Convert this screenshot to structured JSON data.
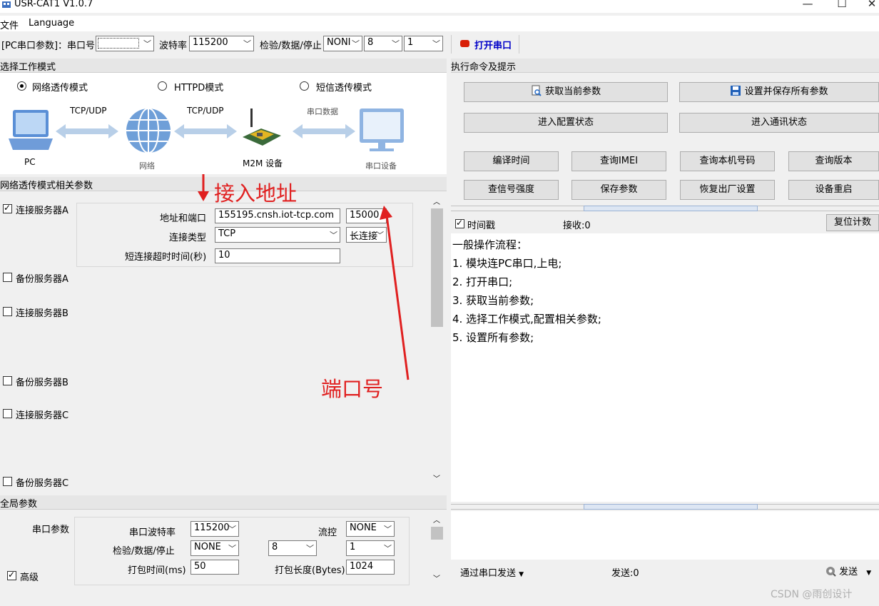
{
  "window": {
    "title": "USR-CAT1 V1.0.7",
    "controls": {
      "minimize": "—",
      "maximize": "☐",
      "close": "✕"
    }
  },
  "menu": {
    "file": "文件",
    "language": "Language"
  },
  "toolbar": {
    "pc_serial_label": "[PC串口参数]：串口号",
    "port_value": "",
    "baud_label": "波特率",
    "baud_value": "115200",
    "parity_label": "检验/数据/停止",
    "parity_value": "NONI",
    "data_bits": "8",
    "stop_bits": "1",
    "open_port_button": "打开串口",
    "accent_color": "#d81e06",
    "button_text_color": "#0000c8"
  },
  "work_mode": {
    "header": "选择工作模式",
    "options": [
      "网络透传模式",
      "HTTPD模式",
      "短信透传模式"
    ],
    "selected_index": 0,
    "diagram": {
      "pc_label": "PC",
      "link1_label": "TCP/UDP",
      "network_label": "网络",
      "link2_label": "TCP/UDP",
      "m2m_label": "M2M 设备",
      "link3_label": "串口数据",
      "serial_device_label": "串口设备"
    }
  },
  "net_params": {
    "header": "网络透传模式相关参数",
    "server_a": {
      "checkbox_label": "连接服务器A",
      "checked": true,
      "addr_label": "地址和端口",
      "address": "155195.cnsh.iot-tcp.com",
      "port": "15000",
      "conn_type_label": "连接类型",
      "conn_type": "TCP",
      "conn_mode": "长连接",
      "timeout_label": "短连接超时时间(秒)",
      "timeout": "10"
    },
    "backup_a": "备份服务器A",
    "server_b": "连接服务器B",
    "backup_b": "备份服务器B",
    "server_c": "连接服务器C",
    "backup_c": "备份服务器C"
  },
  "annotations": {
    "address": "接入地址",
    "port": "端口号"
  },
  "global_params": {
    "header": "全局参数",
    "serial_params_label": "串口参数",
    "baud_label": "串口波特率",
    "baud_value": "115200",
    "flow_label": "流控",
    "flow_value": "NONE",
    "parity_label": "检验/数据/停止",
    "parity_value": "NONE",
    "data_bits": "8",
    "stop_bits": "1",
    "pack_time_label": "打包时间(ms)",
    "pack_time": "50",
    "pack_len_label": "打包长度(Bytes)",
    "pack_len": "1024",
    "advanced_label": "高级",
    "advanced_checked": true
  },
  "commands": {
    "header": "执行命令及提示",
    "get_params": "获取当前参数",
    "set_save_all": "设置并保存所有参数",
    "enter_config": "进入配置状态",
    "enter_comm": "进入通讯状态",
    "compile_time": "编译时间",
    "query_imei": "查询IMEI",
    "query_number": "查询本机号码",
    "query_version": "查询版本",
    "signal_strength": "查信号强度",
    "save_params": "保存参数",
    "factory_reset": "恢复出厂设置",
    "restart": "设备重启"
  },
  "log": {
    "timestamp_label": "时间戳",
    "timestamp_checked": true,
    "recv_label": "接收:0",
    "reset_count": "复位计数",
    "lines": [
      "一般操作流程：",
      "1. 模块连PC串口,上电;",
      "2. 打开串口;",
      "3. 获取当前参数;",
      "4. 选择工作模式,配置相关参数;",
      "5. 设置所有参数;"
    ]
  },
  "send": {
    "via_label": "通过串口发送",
    "sent_label": "发送:0",
    "send_button": "发送"
  },
  "watermark": "CSDN @雨创设计"
}
